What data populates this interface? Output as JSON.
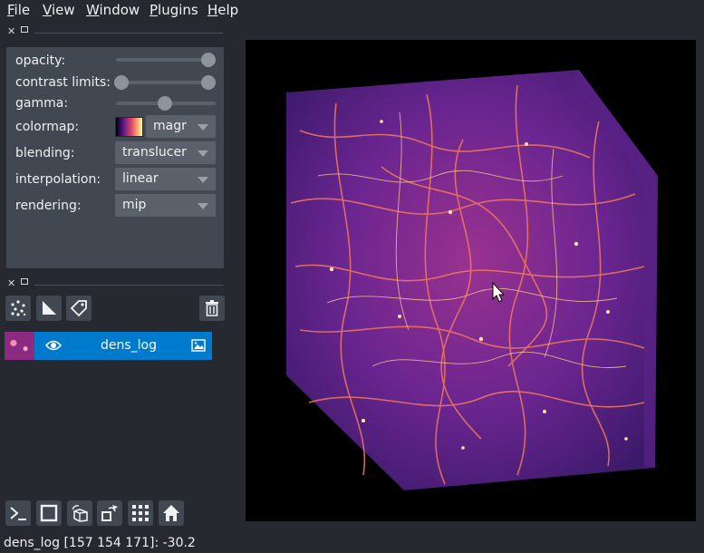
{
  "menu": [
    "File",
    "View",
    "Window",
    "Plugins",
    "Help"
  ],
  "layer_controls": {
    "opacity_label": "opacity:",
    "opacity_value": 1.0,
    "contrast_limits_label": "contrast limits:",
    "contrast_limits_range": [
      0.0,
      1.0
    ],
    "gamma_label": "gamma:",
    "gamma_value": 0.5,
    "colormap_label": "colormap:",
    "colormap_value": "magr",
    "blending_label": "blending:",
    "blending_value": "translucer",
    "interpolation_label": "interpolation:",
    "interpolation_value": "linear",
    "rendering_label": "rendering:",
    "rendering_value": "mip"
  },
  "layer_tools": [
    "points-icon",
    "shapes-icon",
    "labels-icon",
    "delete-icon"
  ],
  "layers": [
    {
      "name": "dens_log",
      "visible": true,
      "selected": true,
      "type_icon": "image-icon"
    }
  ],
  "viewer_buttons": [
    "console-icon",
    "ndisplay-icon",
    "roll-icon",
    "transpose-icon",
    "grid-icon",
    "home-icon"
  ],
  "status_bar": "dens_log [157 154 171]: -30.2",
  "colors": {
    "background": "#262930",
    "panel": "#414851",
    "control": "#5a616b",
    "selected_layer": "#007acc",
    "canvas": "#000000"
  }
}
